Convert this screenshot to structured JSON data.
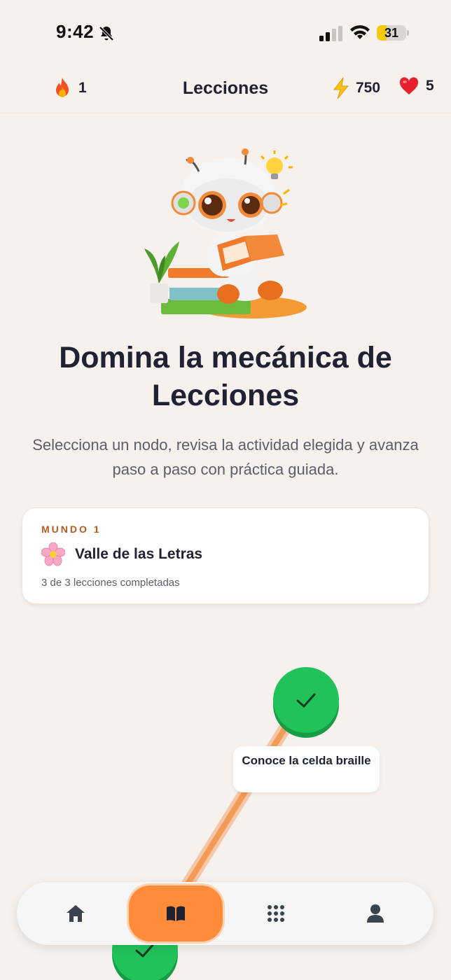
{
  "status_bar": {
    "time": "9:42",
    "battery": "31",
    "icons": [
      "bell-off-icon",
      "signal-icon",
      "wifi-icon",
      "battery-icon"
    ]
  },
  "header": {
    "title": "Lecciones",
    "streak": "1",
    "energy": "750",
    "hearts": "5"
  },
  "hero": {
    "title": "Domina la mecánica de Lecciones",
    "subtitle": "Selecciona un nodo, revisa la actividad elegida y avanza paso a paso con práctica guiada."
  },
  "world": {
    "eyebrow": "MUNDO 1",
    "name": "Valle de las Letras",
    "progress": "3 de 3 lecciones completadas",
    "completed": 3,
    "total": 3
  },
  "path": {
    "nodes": [
      {
        "label": "Conoce la celda braille",
        "status": "completed"
      },
      {
        "label": "",
        "status": "completed"
      }
    ]
  },
  "nav": {
    "items": [
      {
        "name": "home",
        "icon": "home-icon",
        "active": false
      },
      {
        "name": "lessons",
        "icon": "book-icon",
        "active": true
      },
      {
        "name": "practice",
        "icon": "grid-icon",
        "active": false
      },
      {
        "name": "profile",
        "icon": "user-icon",
        "active": false
      }
    ]
  },
  "colors": {
    "background": "#f6f1ed",
    "accent": "#ff8c3b",
    "success": "#22c25a",
    "eyebrow": "#b25a1f",
    "text": "#1f2233"
  }
}
